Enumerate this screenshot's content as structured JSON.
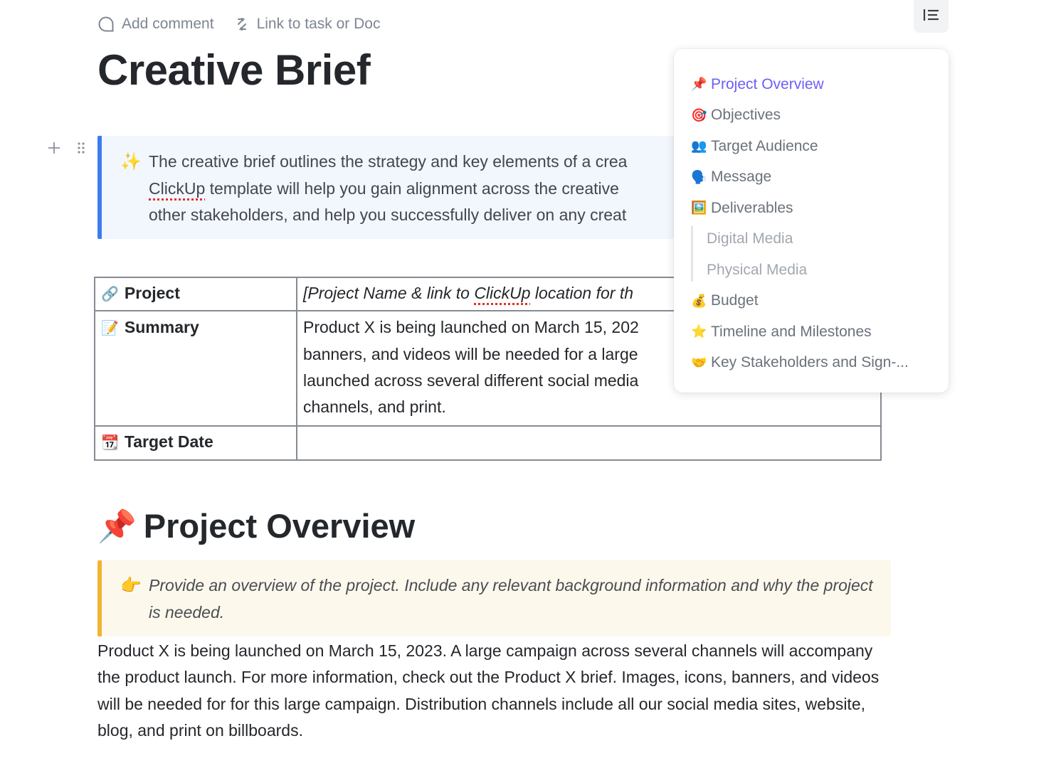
{
  "toolbar": {
    "add_comment": "Add comment",
    "link_task": "Link to task or Doc"
  },
  "doc": {
    "title": "Creative Brief"
  },
  "intro_callout": {
    "emoji": "✨",
    "lines": [
      [
        "The creative brief outlines the strategy and key elements of a crea"
      ],
      [
        "ClickUp",
        " template will help you gain alignment across the creative "
      ],
      [
        "other stakeholders, and help you successfully deliver on any creat"
      ]
    ],
    "line1": "The creative brief outlines the strategy and key elements of a crea",
    "line2_link": "ClickUp",
    "line2_rest": " template will help you gain alignment across the creative ",
    "line3": "other stakeholders, and help you successfully deliver on any creat"
  },
  "table": {
    "rows": [
      {
        "emoji": "🔗",
        "key": "Project",
        "value_pre": "[Project Name & link to ",
        "value_link": "ClickUp",
        "value_post": " location for th"
      },
      {
        "emoji": "📝",
        "key": "Summary",
        "value_lines": [
          "Product X is being launched on March 15, 202",
          "banners, and videos will be needed for a large",
          "launched across several different social media",
          "channels, and print."
        ]
      },
      {
        "emoji": "📆",
        "key": "Target Date",
        "value": ""
      }
    ]
  },
  "section": {
    "emoji": "📌",
    "heading": "Project Overview",
    "hint_emoji": "👉",
    "hint": "Provide an overview of the project. Include any relevant background information and why the project is needed.",
    "body": "Product X is being launched on March 15, 2023. A large campaign across several channels will accompany the product launch. For more information, check out the Product X brief. Images, icons, banners, and videos will be needed for for this large campaign. Distribution channels include all our social media sites, website, blog, and print on billboards."
  },
  "toc": {
    "items": [
      {
        "emoji": "📌",
        "label": "Project Overview",
        "active": true
      },
      {
        "emoji": "🎯",
        "label": "Objectives"
      },
      {
        "emoji": "👥",
        "label": "Target Audience"
      },
      {
        "emoji": "🗣️",
        "label": "Message"
      },
      {
        "emoji": "🖼️",
        "label": "Deliverables"
      }
    ],
    "sub_items": [
      {
        "label": "Digital Media"
      },
      {
        "label": "Physical Media"
      }
    ],
    "items_after": [
      {
        "emoji": "💰",
        "label": "Budget"
      },
      {
        "emoji": "⭐",
        "label": "Timeline and Milestones"
      },
      {
        "emoji": "🤝",
        "label": "Key Stakeholders and Sign-..."
      }
    ]
  },
  "colors": {
    "accent": "#6d5ef5",
    "info_bar": "#3d7cf0",
    "hint_bar": "#f1b434",
    "spellcheck": "#e0312b"
  }
}
